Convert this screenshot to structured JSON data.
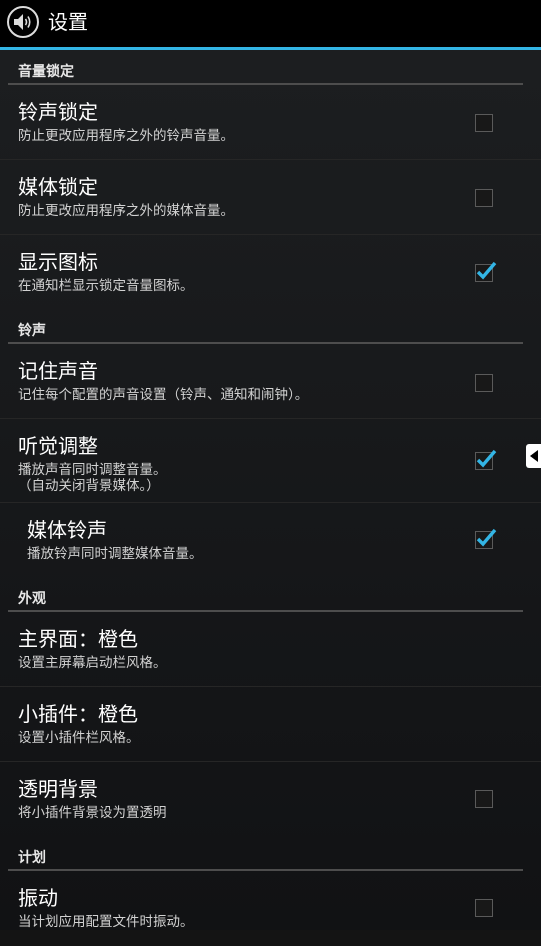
{
  "app": {
    "title": "设置",
    "icon": "volume-icon"
  },
  "sections": {
    "volume_lock": {
      "header": "音量锁定",
      "ringer_lock": {
        "title": "铃声锁定",
        "summary": "防止更改应用程序之外的铃声音量。",
        "checked": false
      },
      "media_lock": {
        "title": "媒体锁定",
        "summary": "防止更改应用程序之外的媒体音量。",
        "checked": false
      },
      "show_icon": {
        "title": "显示图标",
        "summary": "在通知栏显示锁定音量图标。",
        "checked": true
      }
    },
    "ringtone": {
      "header": "铃声",
      "remember_sound": {
        "title": "记住声音",
        "summary": "记住每个配置的声音设置（铃声、通知和闹钟）。",
        "checked": false
      },
      "listen_adjust": {
        "title": "听觉调整",
        "summary": "播放声音同时调整音量。\n（自动关闭背景媒体。）",
        "checked": true
      },
      "media_ringtone": {
        "title": "媒体铃声",
        "summary": "播放铃声同时调整媒体音量。",
        "checked": true
      }
    },
    "appearance": {
      "header": "外观",
      "home_theme": {
        "title": "主界面：橙色",
        "summary": "设置主屏幕启动栏风格。"
      },
      "widget_theme": {
        "title": "小插件：橙色",
        "summary": "设置小插件栏风格。"
      },
      "transparent_bg": {
        "title": "透明背景",
        "summary": "将小插件背景设为置透明",
        "checked": false
      }
    },
    "schedule": {
      "header": "计划",
      "vibrate": {
        "title": "振动",
        "summary": "当计划应用配置文件时振动。",
        "checked": false
      }
    }
  },
  "colors": {
    "accent": "#33b5e5",
    "background": "#141414",
    "actionbar": "#000000"
  }
}
